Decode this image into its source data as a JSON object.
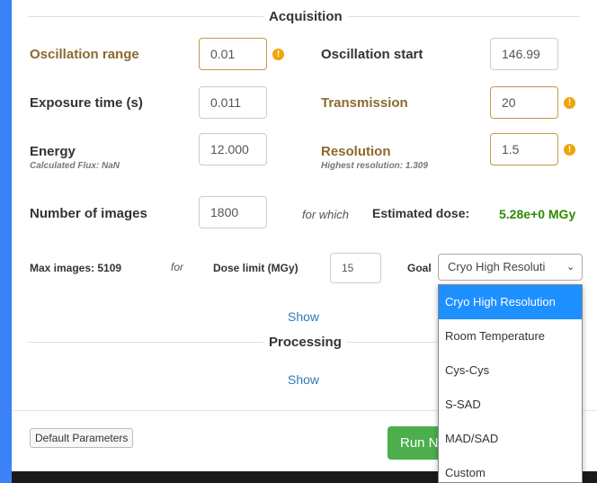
{
  "acquisition": {
    "title": "Acquisition",
    "oscillation_range": {
      "label": "Oscillation range",
      "value": "0.01",
      "warning": "!"
    },
    "oscillation_start": {
      "label": "Oscillation start",
      "value": "146.99"
    },
    "exposure_time": {
      "label": "Exposure time (s)",
      "value": "0.011"
    },
    "transmission": {
      "label": "Transmission",
      "value": "20",
      "warning": "!"
    },
    "energy": {
      "label": "Energy",
      "sub": "Calculated Flux: NaN",
      "value": "12.000"
    },
    "resolution": {
      "label": "Resolution",
      "sub": "Highest resolution: 1.309",
      "value": "1.5",
      "warning": "!"
    },
    "num_images": {
      "label": "Number of images",
      "value": "1800"
    },
    "for_which": "for which",
    "estimated_dose_label": "Estimated dose:",
    "estimated_dose_value": "5.28e+0 MGy",
    "max_images": "Max images: 5109",
    "for": "for",
    "dose_limit_label": "Dose limit (MGy)",
    "dose_limit_value": "15",
    "goal_label": "Goal",
    "goal_selected": "Cryo High Resoluti",
    "goal_options": [
      "Cryo High Resolution",
      "Room Temperature",
      "Cys-Cys",
      "S-SAD",
      "MAD/SAD",
      "Custom"
    ],
    "show": "Show"
  },
  "processing": {
    "title": "Processing",
    "show": "Show"
  },
  "footer": {
    "default_parameters": "Default Parameters",
    "run": "Run N"
  },
  "colors": {
    "accent_gold": "#8b6a2e",
    "dose_green": "#2e8b00",
    "selected_blue": "#1e90ff",
    "warning": "#f0a40a",
    "run_green": "#4cae4c"
  }
}
